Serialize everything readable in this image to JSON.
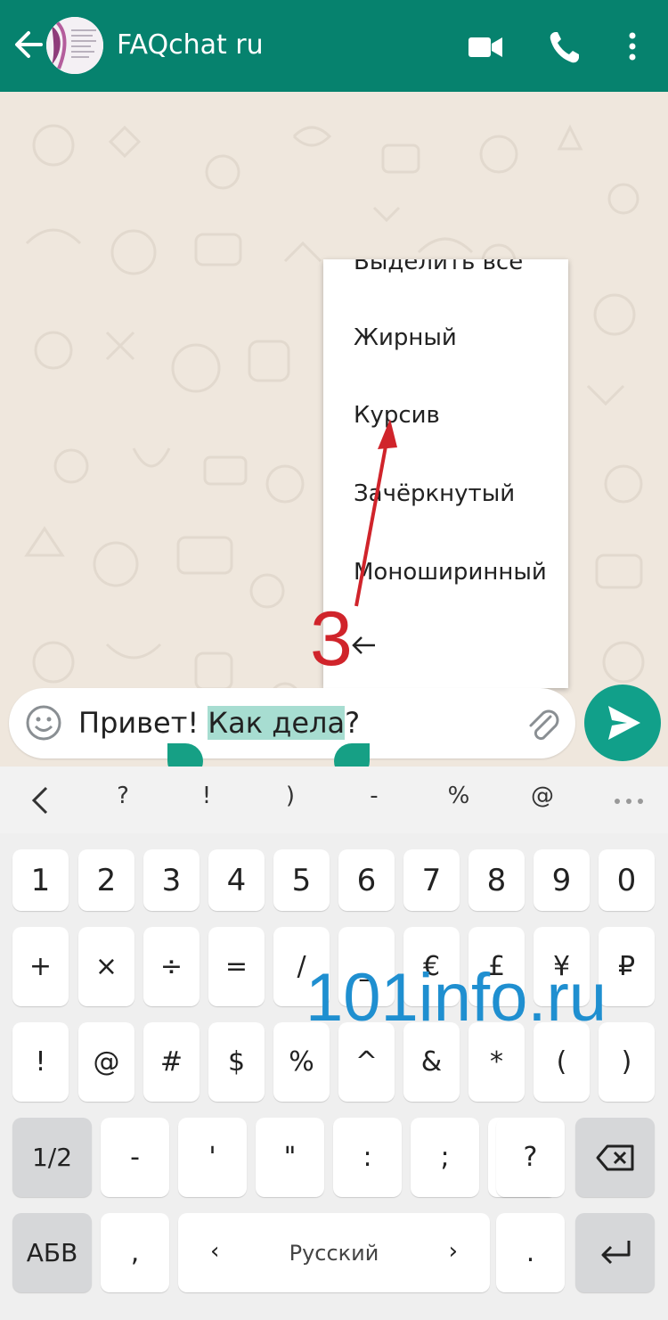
{
  "header": {
    "title": "FAQchat ru"
  },
  "menu": {
    "items": [
      "Выделить все",
      "Жирный",
      "Курсив",
      "Зачёркнутый",
      "Моноширинный"
    ]
  },
  "composer": {
    "text_before": "Привет! ",
    "selected": "Как дела",
    "text_after": "?"
  },
  "keyboard": {
    "suggest": [
      "?",
      "!",
      ")",
      "-",
      "%",
      "@"
    ],
    "row1": [
      "1",
      "2",
      "3",
      "4",
      "5",
      "6",
      "7",
      "8",
      "9",
      "0"
    ],
    "row2": [
      "+",
      "×",
      "÷",
      "=",
      "/",
      "_",
      "€",
      "£",
      "¥",
      "₽"
    ],
    "row3": [
      "!",
      "@",
      "#",
      "$",
      "%",
      "^",
      "&",
      "*",
      "(",
      ")"
    ],
    "row4": [
      "1/2",
      "-",
      "'",
      "\"",
      ":",
      ";",
      "'",
      "?"
    ],
    "row5": {
      "lang_switch": "АБВ",
      "comma": ",",
      "space_label": "Русский",
      "dot": "."
    }
  },
  "annotation": {
    "step": "3"
  },
  "watermark": "101info.ru",
  "colors": {
    "header": "#06826e",
    "accent": "#11a08a",
    "selection": "#a7ddd1",
    "annotation": "#d0242b",
    "watermark": "#1f8fd0"
  },
  "icons": [
    "back-arrow-icon",
    "video-call-icon",
    "phone-icon",
    "more-vert-icon",
    "emoji-icon",
    "attach-icon",
    "send-icon",
    "chevron-left-icon",
    "more-horiz-icon",
    "backspace-icon",
    "enter-icon"
  ]
}
